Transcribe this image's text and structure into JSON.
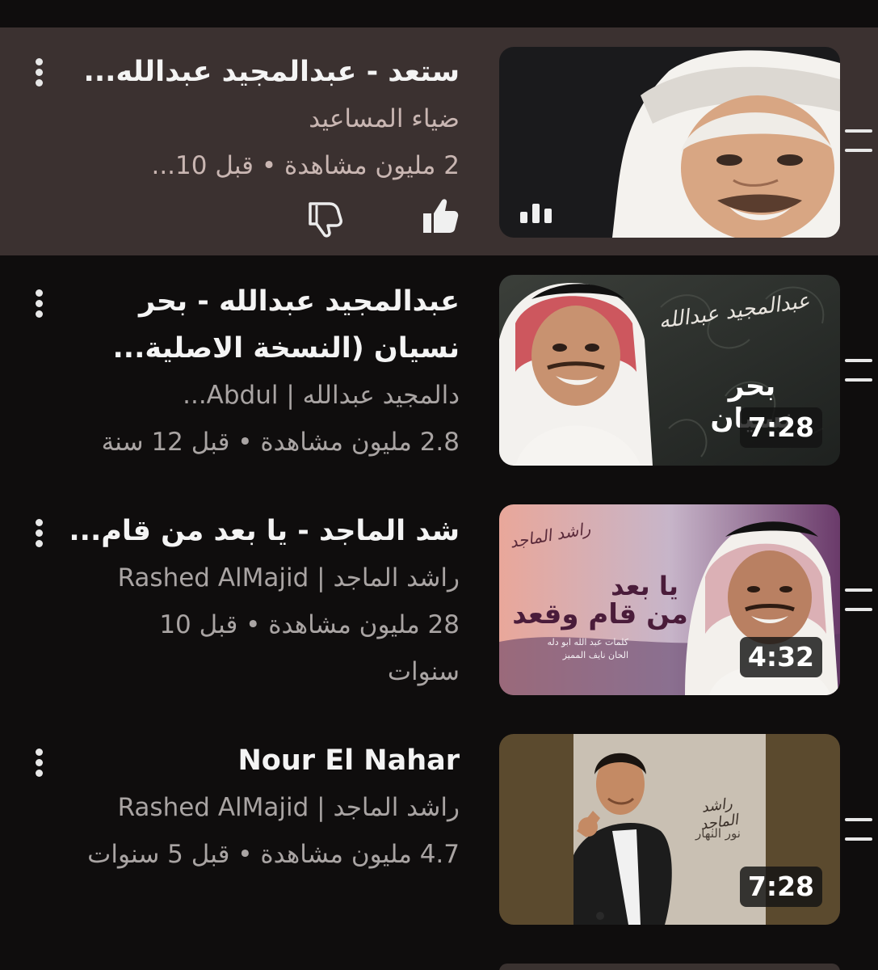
{
  "queue": [
    {
      "title": "ستعد - عبدالمجيد عبدالله...",
      "channel": "ضياء المساعيد",
      "meta": "2 مليون مشاهدة • قبل 10...",
      "duration": "",
      "playing": true,
      "icons": {
        "playing": "equalizer-icon",
        "like": "thumbs-up-icon",
        "dislike": "thumbs-down-icon"
      }
    },
    {
      "title": "عبدالمجيد عبدالله - بحر نسيان (النسخة الاصلية...",
      "channel": "دالمجيد عبدالله | Abdul...",
      "meta": "2.8 مليون مشاهدة • قبل 12 سنة",
      "duration": "7:28",
      "thumb_text": "بحر نسيان",
      "thumb_script": "عبدالمجيد عبدالله"
    },
    {
      "title": "شد الماجد - يا بعد من قام...",
      "channel": "راشد الماجد | Rashed AlMajid",
      "meta": "28 مليون مشاهدة • قبل 10 سنوات",
      "duration": "4:32",
      "thumb_text_1": "يا بعد",
      "thumb_text_2": "من قام وقعد",
      "thumb_credit_1": "كلمات عبد الله ابو دله",
      "thumb_credit_2": "الحان نايف المميز",
      "thumb_script": "راشد الماجد"
    },
    {
      "title": "Nour El Nahar",
      "channel": "راشد الماجد | Rashed AlMajid",
      "meta": "4.7 مليون مشاهدة • قبل 5 سنوات",
      "duration": "7:28",
      "thumb_script": "راشد الماجد",
      "thumb_text": "نور النهار"
    }
  ],
  "colors": {
    "background": "#0f0d0d",
    "active_row": "#3b3130",
    "primary_text": "#f4f4f4",
    "secondary_text": "#a9a4a3"
  },
  "icons": {
    "menu": "more-vert-icon",
    "drag": "drag-handle-icon"
  }
}
